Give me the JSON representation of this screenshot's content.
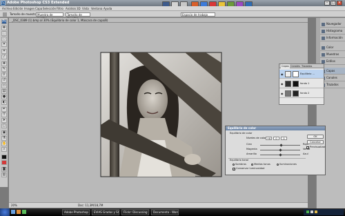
{
  "window": {
    "title": "Adobe Photoshop CS3 Extended",
    "logo_text": "Ps"
  },
  "menu": [
    "Archivo",
    "Edición",
    "Imagen",
    "Capa",
    "Selección",
    "Filtro",
    "Análisis",
    "3D",
    "Vista",
    "Ventana",
    "Ayuda"
  ],
  "options": {
    "sample_label": "Tamaño de muestra:",
    "sample_value": "Muestra de puntos",
    "layer_value": "Tamaño de muestra",
    "workspace_label": "Espacio de trabajo"
  },
  "document": {
    "tab_title": "_DSC_0389 (1).bmp al 30% (Equilibrio de color 1, Máscara de capa/8)",
    "zoom": "20%",
    "doc_info": "Doc: 11,3M/18,7M"
  },
  "dock": {
    "items": [
      "Navegador",
      "Histograma",
      "Información",
      "Color",
      "Muestras",
      "Estilos",
      "Capas",
      "Canales",
      "Trazados"
    ]
  },
  "layers_panel": {
    "tabs": [
      "Capas",
      "Canales",
      "Trazados"
    ],
    "rows": [
      {
        "name": "Equilibrio ...",
        "active": true
      },
      {
        "name": "fondo 1",
        "active": false
      },
      {
        "name": "fondo 2",
        "active": false
      }
    ]
  },
  "dialog": {
    "title": "Equilibrio de color",
    "group_label": "Equilibrio de color",
    "levels_label": "Niveles de color:",
    "levels": [
      "+6",
      "0",
      "0"
    ],
    "sliders": [
      {
        "left": "Cian",
        "right": "Rojo",
        "value": 6
      },
      {
        "left": "Magenta",
        "right": "Verde",
        "value": 0
      },
      {
        "left": "Amarillo",
        "right": "Azul",
        "value": 0
      }
    ],
    "tone_label": "Equilibrio tonal",
    "tones": [
      "Sombras",
      "Medios tonos",
      "Iluminaciones"
    ],
    "selected_tone": "Medios tonos",
    "preserve_label": "Conservar luminosidad",
    "preserve_checked": true,
    "ok_label": "OK",
    "cancel_label": "Cancelar",
    "preview_label": "Previsualizar",
    "preview_checked": true
  },
  "taskbar": {
    "buttons": [
      "Adobe Photoshop CS...",
      "EVIAS Grados y Sh...",
      "Flickr: Discussing Pho...",
      "Documento - WordPad"
    ]
  }
}
